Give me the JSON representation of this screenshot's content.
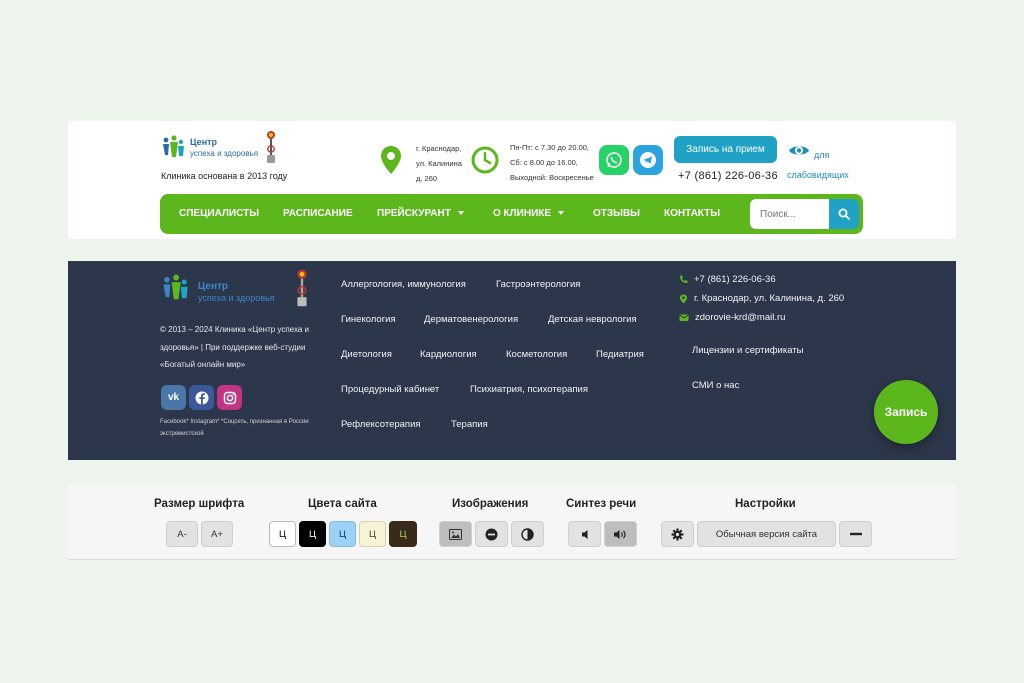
{
  "header": {
    "brand_line1": "Центр",
    "brand_line2": "успеха и здоровья",
    "founded": "Клиника основана в 2013 году",
    "address": [
      "г. Краснодар,",
      "ул. Калинина",
      "д. 260"
    ],
    "hours": [
      "Пн-Пт: с 7.30 до 20.00,",
      "Сб: с 8.00 до 16.00,",
      "Выходной: Воскресенье"
    ],
    "book_label": "Запись на прием",
    "phone": "+7 (861) 226-06-36",
    "vi_label_1": "для",
    "vi_label_2": "слабовидящих",
    "nav": [
      {
        "label": "Специалисты"
      },
      {
        "label": "Расписание"
      },
      {
        "label": "Прейскурант"
      },
      {
        "label": "О клинике"
      },
      {
        "label": "Отзывы"
      },
      {
        "label": "Контакты"
      }
    ],
    "search_placeholder": "Поиск..."
  },
  "footer": {
    "brand_line1": "Центр",
    "brand_line2": "успеха и здоровья",
    "copyright": "© 2013 – 2024 Клиника «Центр успеха и здоровья» | При поддержке веб-студии «Богатый онлайн мир»",
    "note": "Facebook* Instagram* *Соцсеть, признанная в России экстремистской",
    "links": [
      "Аллергология, иммунология",
      "Гастроэнтерология",
      "Гинекология",
      "Дерматовенерология",
      "Детская неврология",
      "Диетология",
      "Кардиология",
      "Косметология",
      "Педиатрия",
      "Процедурный кабинет",
      "Психиатрия, психотерапия",
      "Рефлексотерапия",
      "Терапия"
    ],
    "phone": "+7 (861) 226-06-36",
    "address": "г. Краснодар, ул. Калинина, д. 260",
    "email": "zdorovie-krd@mail.ru",
    "licenses": "Лицензии и сертификаты",
    "media": "СМИ о нас",
    "cta": "Запись"
  },
  "accessibility": {
    "font_size_title": "Размер шрифта",
    "font_minus": "A-",
    "font_plus": "A+",
    "colors_title": "Цвета сайта",
    "color_letter": "Ц",
    "images_title": "Изображения",
    "speech_title": "Синтез речи",
    "settings_title": "Настройки",
    "normal_version": "Обычная версия сайта"
  },
  "colors": {
    "brand_green": "#5cb71c",
    "accent_blue": "#1fa2c6",
    "footer_bg": "#2d374b",
    "whatsapp": "#25d366",
    "telegram": "#2aa3de"
  }
}
